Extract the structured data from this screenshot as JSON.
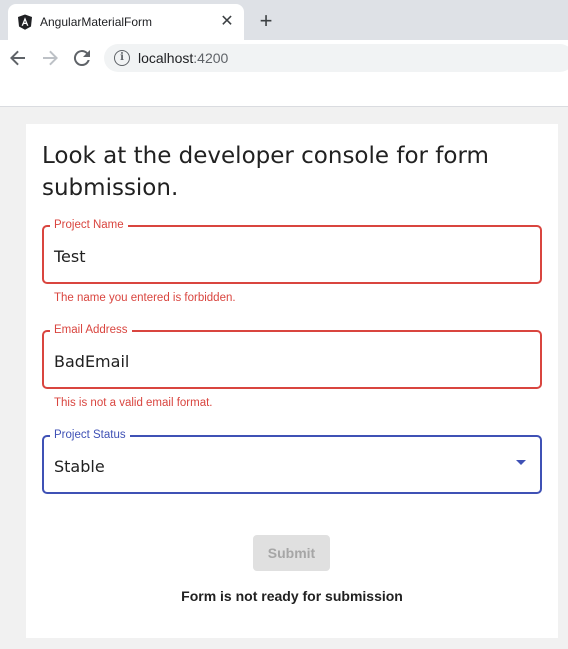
{
  "browser": {
    "tab_title": "AngularMaterialForm",
    "tab_close": "✕",
    "new_tab": "+",
    "url_host": "localhost",
    "url_port": ":4200",
    "icons": {
      "back": "arrow-left-icon",
      "forward": "arrow-right-icon",
      "reload": "reload-icon",
      "info": "info-icon"
    }
  },
  "form": {
    "heading": "Look at the developer console for form submission.",
    "project_name": {
      "label": "Project Name",
      "value": "Test",
      "error": "The name you entered is forbidden."
    },
    "email": {
      "label": "Email Address",
      "value": "BadEmail",
      "error": "This is not a valid email format."
    },
    "status": {
      "label": "Project Status",
      "selected": "Stable"
    },
    "submit_label": "Submit",
    "submit_message": "Form is not ready for submission"
  },
  "colors": {
    "error": "#d9453f",
    "primary": "#3f51b5",
    "disabled_bg": "#e0e0e0",
    "disabled_text": "#a6a6a6"
  }
}
